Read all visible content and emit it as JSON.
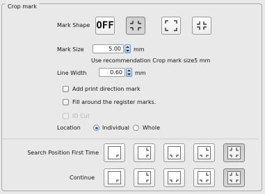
{
  "group_title": "Crop mark",
  "mark_shape": {
    "label": "Mark Shape",
    "options": [
      {
        "name": "off",
        "text": "OFF",
        "selected": false
      },
      {
        "name": "japanese-style",
        "text": "",
        "selected": true
      },
      {
        "name": "corner-style",
        "text": "",
        "selected": false
      },
      {
        "name": "inner-corner-style",
        "text": "",
        "selected": false
      }
    ]
  },
  "mark_size": {
    "label": "Mark Size",
    "value": "5.00",
    "unit": "mm",
    "recommendation": "Use recommendation Crop mark size5 mm"
  },
  "line_width": {
    "label": "Line Width",
    "value": "0.60",
    "unit": "mm"
  },
  "checkboxes": {
    "print_direction": {
      "label": "Add print direction mark",
      "checked": false,
      "disabled": false
    },
    "fill_register": {
      "label": "Fill around the register marks.",
      "checked": false,
      "disabled": false
    },
    "id_cut": {
      "label": "ID Cut",
      "checked": false,
      "disabled": true
    }
  },
  "location": {
    "label": "Location",
    "options": [
      {
        "label": "Individual",
        "selected": true
      },
      {
        "label": "Whole",
        "selected": false
      }
    ]
  },
  "search_position": {
    "first_time_label": "Search Position First Time",
    "continue_label": "Continue",
    "first_time_selected": 4,
    "continue_selected": 4
  },
  "colors": {
    "selection_blue": "#3a6fd0",
    "spinner_blue": "#9fc0e6"
  }
}
